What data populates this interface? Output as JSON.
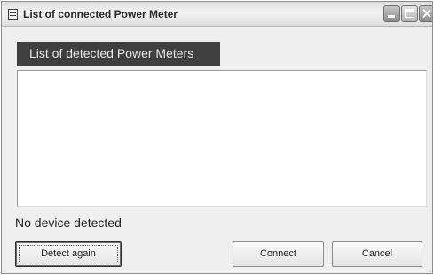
{
  "window": {
    "title": "List of connected Power Meter",
    "controls": {
      "minimize_icon": "minimize-icon",
      "maximize_icon": "maximize-icon",
      "close_icon": "close-icon"
    }
  },
  "panel": {
    "header": "List of detected Power Meters",
    "items": []
  },
  "status": {
    "text": "No device detected"
  },
  "buttons": {
    "detect_again": "Detect again",
    "connect": "Connect",
    "cancel": "Cancel"
  },
  "colors": {
    "header_background": "#3f3f3f",
    "header_text": "#e8e8e8",
    "window_background": "#efefef",
    "list_background": "#ffffff"
  }
}
